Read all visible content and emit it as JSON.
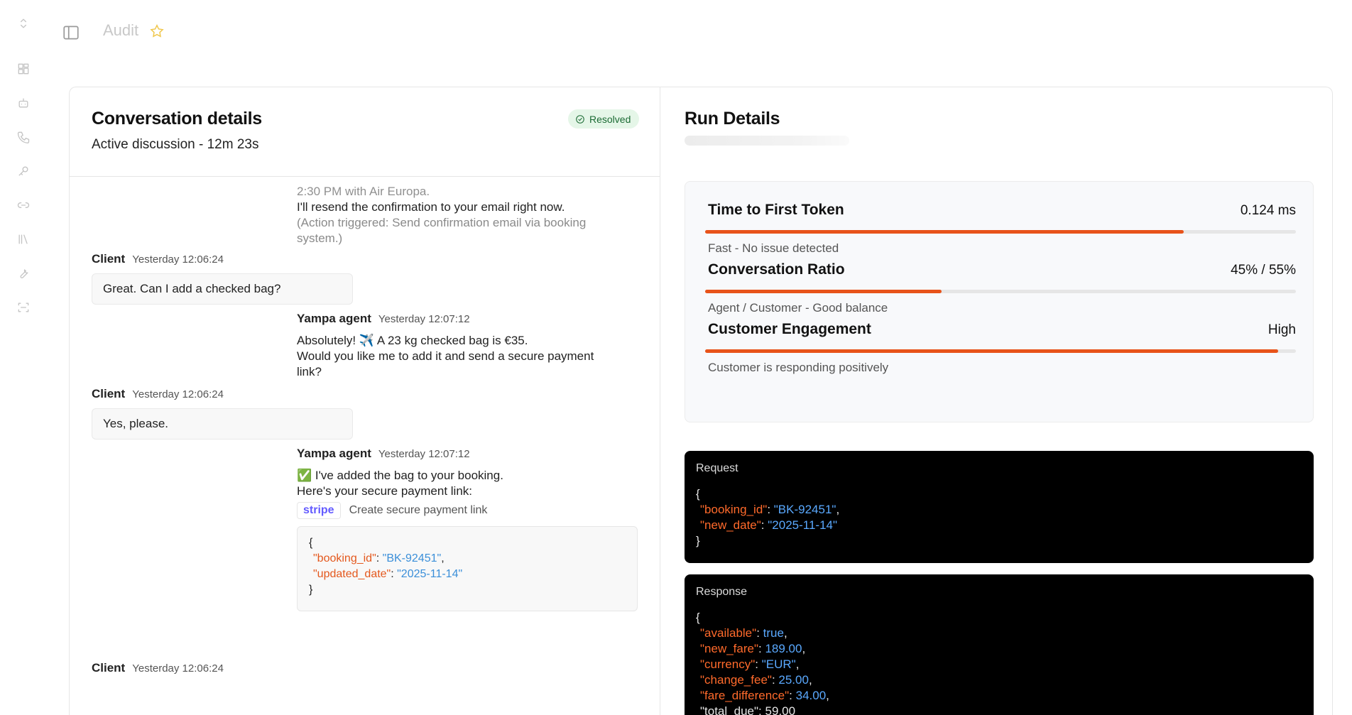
{
  "header": {
    "title": "Audit"
  },
  "sidebar": {
    "icons": [
      "chevrons-up-down-icon",
      "dashboard-icon",
      "bot-icon",
      "phone-icon",
      "key-icon",
      "link-icon",
      "library-icon",
      "wrench-icon",
      "scan-icon"
    ]
  },
  "conversation": {
    "title": "Conversation details",
    "subtitle": "Active discussion - 12m 23s",
    "status": "Resolved",
    "faded_text": [
      "2:30 PM with Air Europa.",
      "I'll resend the confirmation to your email right now.",
      "(Action triggered: Send confirmation email via booking",
      "system.)"
    ],
    "messages": [
      {
        "who": "Client",
        "time": "Yesterday 12:06:24",
        "text": "Great. Can I add a checked bag?"
      },
      {
        "who": "Yampa agent",
        "time": "Yesterday 12:07:12",
        "lines": [
          "Absolutely! ✈️ A 23 kg checked bag is €35.",
          " Would you like me to add it and send a secure payment",
          "link?"
        ]
      },
      {
        "who": "Client",
        "time": "Yesterday 12:06:24",
        "text": "Yes, please."
      },
      {
        "who": "Yampa agent",
        "time": "Yesterday 12:07:12",
        "lines": [
          "✅ I've added the bag to your booking.",
          " Here's your secure payment link:"
        ]
      },
      {
        "who": "Client",
        "time": "Yesterday 12:06:24"
      }
    ],
    "tool": {
      "name": "stripe",
      "action": "Create secure payment link",
      "code": {
        "open": "{",
        "close": "}",
        "k1": "\"booking_id\"",
        "v1": "\"BK-92451\"",
        "k2": "\"updated_date\"",
        "v2": "\"2025-11-14\""
      }
    }
  },
  "run": {
    "title": "Run Details",
    "metrics": [
      {
        "name": "Time to First Token",
        "value": "0.124 ms",
        "note": "Fast - No issue detected",
        "fill": 0.81
      },
      {
        "name": "Conversation Ratio",
        "value": "45% / 55%",
        "note": "Agent / Customer - Good balance",
        "fill": 0.4
      },
      {
        "name": "Customer Engagement",
        "value": "High",
        "note": "Customer is responding positively",
        "fill": 0.97
      }
    ],
    "request": {
      "title": "Request",
      "open": "{",
      "close": "}",
      "k1": "\"booking_id\"",
      "v1": "\"BK-92451\"",
      "k2": "\"new_date\"",
      "v2": "\"2025-11-14\""
    },
    "response": {
      "title": "Response",
      "open": "{",
      "k1": "\"available\"",
      "v1": "true",
      "k2": "\"new_fare\"",
      "v2": "189.00",
      "k3": "\"currency\"",
      "v3": "\"EUR\"",
      "k4": "\"change_fee\"",
      "v4": "25.00",
      "k5": "\"fare_difference\"",
      "v5": "34.00",
      "k6": "\"total_due\"",
      "v6": "59.00"
    }
  }
}
